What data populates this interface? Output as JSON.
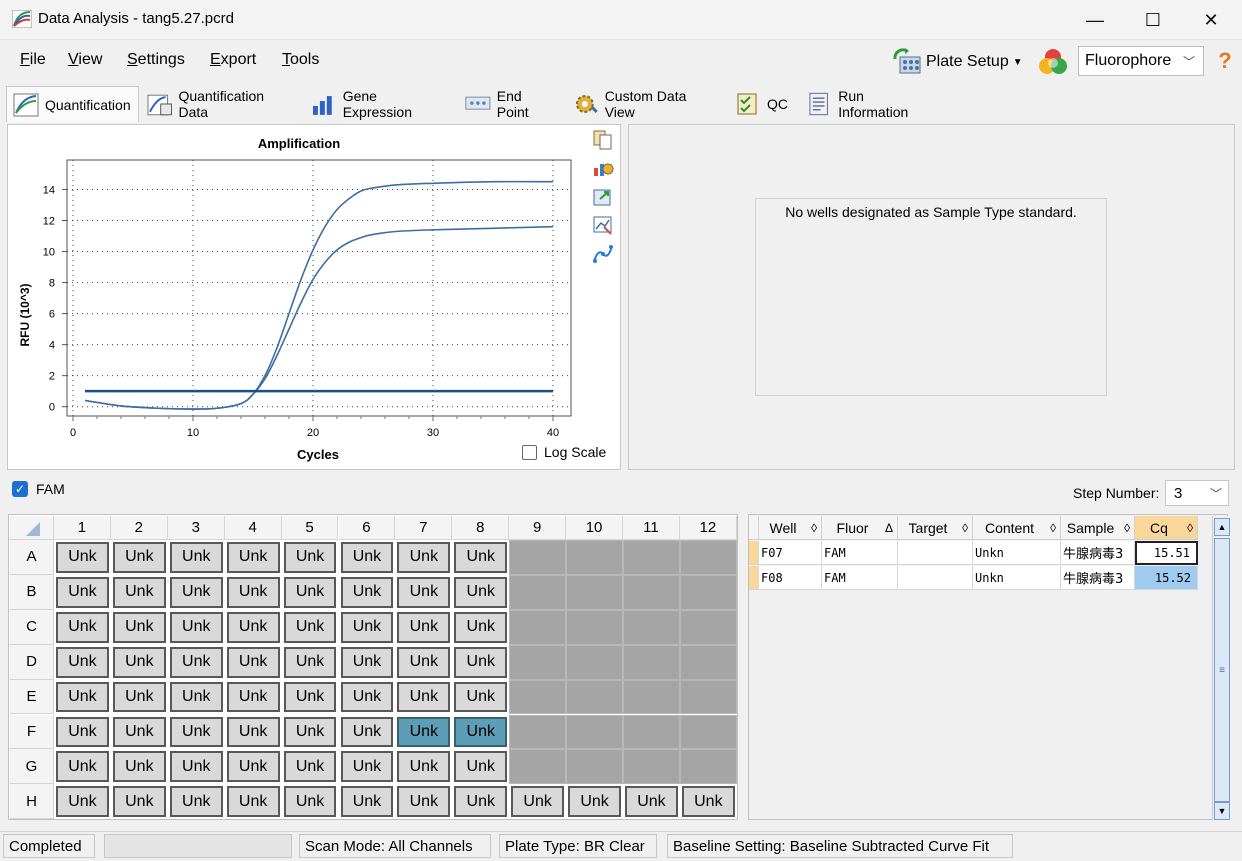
{
  "window": {
    "title": "Data Analysis - tang5.27.pcrd",
    "controls": [
      "—",
      "☐",
      "✕"
    ]
  },
  "menu": {
    "items": [
      "File",
      "View",
      "Settings",
      "Export",
      "Tools"
    ],
    "plate_setup": "Plate Setup",
    "fluorophore": "Fluorophore"
  },
  "tabs": [
    "Quantification",
    "Quantification Data",
    "Gene Expression",
    "End Point",
    "Custom Data View",
    "QC",
    "Run Information"
  ],
  "chart": {
    "title": "Amplification",
    "xlabel": "Cycles",
    "ylabel": "RFU (10^3)",
    "log_scale_label": "Log Scale"
  },
  "chart_data": {
    "type": "line",
    "title": "Amplification",
    "xlabel": "Cycles",
    "ylabel": "RFU (10^3)",
    "xlim": [
      0,
      40
    ],
    "ylim": [
      0,
      15
    ],
    "xticks": [
      0,
      10,
      20,
      30,
      40
    ],
    "yticks": [
      0,
      2,
      4,
      6,
      8,
      10,
      12,
      14
    ],
    "grid": true,
    "log_scale": false,
    "threshold": 1.0,
    "series": [
      {
        "color": "#3c6ea2",
        "x": [
          1,
          4,
          7,
          10,
          12,
          14,
          15,
          16,
          17,
          18,
          19,
          20,
          21,
          22,
          23,
          24,
          25,
          27,
          30,
          35,
          40
        ],
        "values": [
          0.4,
          0.05,
          -0.1,
          -0.15,
          -0.1,
          0.2,
          0.8,
          2.0,
          3.8,
          6.0,
          8.2,
          10.1,
          11.6,
          12.7,
          13.4,
          13.9,
          14.1,
          14.3,
          14.4,
          14.5,
          14.5
        ]
      },
      {
        "color": "#3c6ea2",
        "x": [
          1,
          4,
          7,
          10,
          12,
          14,
          15,
          16,
          17,
          18,
          19,
          20,
          21,
          22,
          23,
          24,
          25,
          27,
          30,
          35,
          40
        ],
        "values": [
          0.4,
          0.05,
          -0.1,
          -0.15,
          -0.1,
          0.2,
          0.8,
          1.8,
          3.3,
          5.0,
          6.7,
          8.2,
          9.3,
          10.1,
          10.6,
          10.9,
          11.1,
          11.3,
          11.4,
          11.5,
          11.6
        ]
      }
    ]
  },
  "standard_panel": {
    "message": "No wells designated as Sample Type standard."
  },
  "fluor_filter": {
    "label": "FAM",
    "step_label": "Step Number:",
    "step_value": "3"
  },
  "plate": {
    "columns": [
      "1",
      "2",
      "3",
      "4",
      "5",
      "6",
      "7",
      "8",
      "9",
      "10",
      "11",
      "12"
    ],
    "rows": [
      "A",
      "B",
      "C",
      "D",
      "E",
      "F",
      "G",
      "H"
    ],
    "well_label": "Unk"
  },
  "results_table": {
    "columns": [
      "Well",
      "Fluor",
      "Target",
      "Content",
      "Sample",
      "Cq"
    ],
    "rows": [
      [
        "F07",
        "FAM",
        "",
        "Unkn",
        "牛腺病毒3",
        "15.51"
      ],
      [
        "F08",
        "FAM",
        "",
        "Unkn",
        "牛腺病毒3",
        "15.52"
      ]
    ]
  },
  "status": {
    "state": "Completed",
    "scan_mode": "Scan Mode: All Channels",
    "plate_type": "Plate Type: BR Clear",
    "baseline": "Baseline Setting: Baseline Subtracted Curve Fit"
  },
  "colors": {
    "accent": "#1f6fd1",
    "selected_well": "#5d9eb6",
    "empty_well": "#a5a5a5",
    "cq_highlight": "#9ecbef",
    "curve": "#3c6ea2",
    "threshold": "#1c4f8a"
  }
}
